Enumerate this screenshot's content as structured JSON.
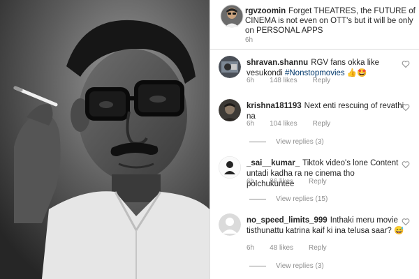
{
  "caption": {
    "username": "rgvzoomin",
    "text": "Forget THEATRES, the FUTURE of CINEMA is not even on OTT's but it will be only on PERSONAL APPS",
    "time": "6h"
  },
  "comments": [
    {
      "username": "shravan.shannu",
      "text_before": "RGV fans okka like vesukondi ",
      "hashtag": "#Nonstopmovies",
      "text_after": " 👍🤩",
      "time": "6h",
      "likes": "148 likes",
      "reply": "Reply"
    },
    {
      "username": "krishna181193",
      "text": "Next enti rescuing of revathi na",
      "time": "6h",
      "likes": "104 likes",
      "reply": "Reply",
      "view_replies": "View replies (3)"
    },
    {
      "username": "_sai__kumar_",
      "text": "Tiktok  video's lone Content untadi kadha ra ne cinema tho polchukuntee",
      "time": "6h",
      "likes": "36 likes",
      "reply": "Reply",
      "view_replies": "View replies (15)"
    },
    {
      "username": "no_speed_limits_999",
      "text": "Inthaki meru movie tisthunattu katrina kaif ki ina telusa saar? 😅",
      "time": "6h",
      "likes": "48 likes",
      "reply": "Reply",
      "view_replies": "View replies (3)"
    }
  ],
  "icons": {
    "heart": "heart-outline-icon",
    "avatar_default": "default-avatar-icon"
  },
  "colors": {
    "hashtag": "#00376b",
    "muted": "#8e8e8e",
    "text": "#262626"
  }
}
